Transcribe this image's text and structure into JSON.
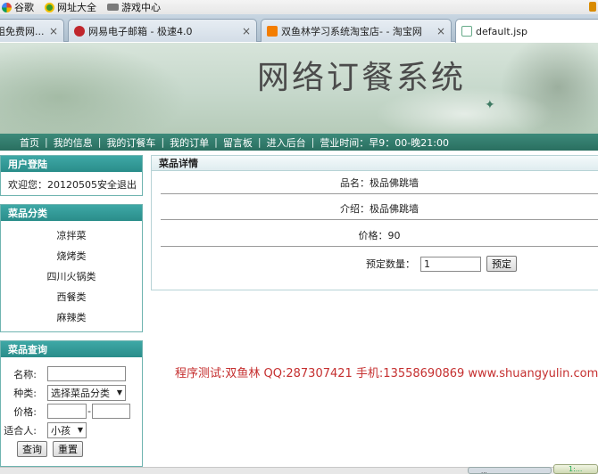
{
  "bookmarks": [
    {
      "label": "谷歌",
      "icon": "google-icon"
    },
    {
      "label": "网址大全",
      "icon": "web-directory-icon"
    },
    {
      "label": "游戏中心",
      "icon": "gamepad-icon"
    }
  ],
  "tabs": [
    {
      "title": "组免费网...",
      "active": false
    },
    {
      "title": "网易电子邮箱 - 极速4.0",
      "active": false
    },
    {
      "title": "双鱼林学习系统淘宝店- - 淘宝网",
      "active": false
    },
    {
      "title": "default.jsp",
      "active": true
    }
  ],
  "tab_close": "×",
  "banner": {
    "title": "网络订餐系统"
  },
  "nav": {
    "items": [
      "首页",
      "我的信息",
      "我的订餐车",
      "我的订单",
      "留言板",
      "进入后台"
    ],
    "hours": "营业时间：早9：00-晚21:00",
    "separator": "|"
  },
  "login": {
    "title": "用户登陆",
    "welcome": "欢迎您：20120505",
    "logout": "安全退出"
  },
  "categories": {
    "title": "菜品分类",
    "items": [
      "凉拌菜",
      "烧烤类",
      "四川火锅类",
      "西餐类",
      "麻辣类"
    ]
  },
  "search": {
    "title": "菜品查询",
    "name_label": "名称:",
    "type_label": "种类:",
    "type_value": "选择菜品分类",
    "price_label": "价格:",
    "price_sep": "-",
    "fit_label": "适合人:",
    "fit_value": "小孩",
    "query_button": "查询",
    "reset_button": "重置"
  },
  "detail": {
    "title": "菜品详情",
    "name": "品名：极品佛跳墙",
    "intro": "介绍：极品佛跳墙",
    "price": "价格：90",
    "qty_label": "预定数量：",
    "qty_value": "1",
    "order_button": "预定"
  },
  "promo": "程序测试:双鱼林 QQ:287307421 手机:13558690869 www.shuangyulin.com",
  "status": {
    "pill": "...",
    "right": "1:..."
  }
}
